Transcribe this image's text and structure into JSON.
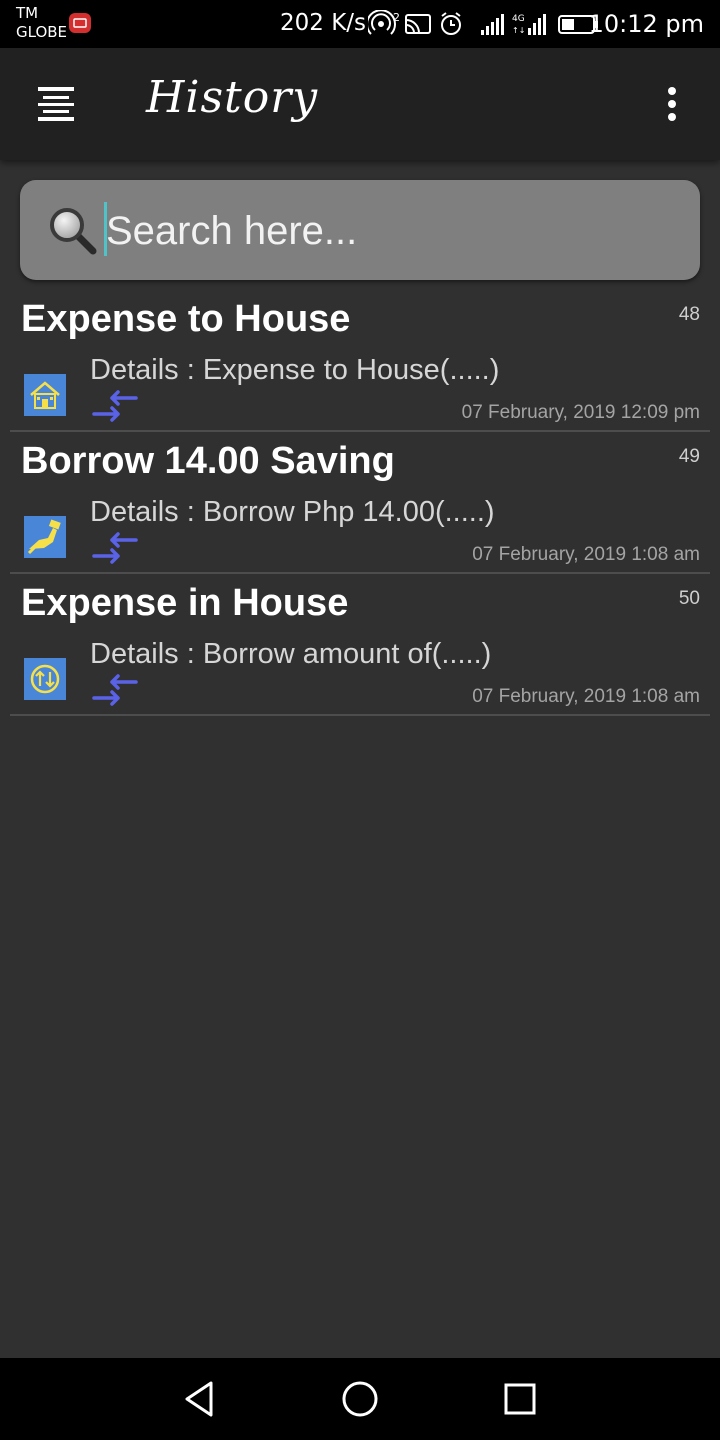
{
  "status_bar": {
    "carrier_line1": "TM",
    "carrier_line2": "GLOBE",
    "net_speed": "202 K/s",
    "time": "10:12 pm",
    "icons": [
      "notification-icon",
      "hotspot-icon",
      "cast-icon",
      "alarm-icon",
      "signal-icon",
      "4g-signal-icon",
      "battery-icon"
    ]
  },
  "app_bar": {
    "title": "History",
    "menu_icon": "hamburger-menu-icon",
    "overflow_icon": "more-vert-icon"
  },
  "search": {
    "placeholder": "Search here...",
    "value": "",
    "icon": "magnifier-icon"
  },
  "history": [
    {
      "title": "Expense to House",
      "number": "48",
      "details": "Details : Expense to House(.....)",
      "date": "07 February, 2019 12:09 pm",
      "icon": "house-icon"
    },
    {
      "title": "Borrow 14.00 Saving",
      "number": "49",
      "details": "Details : Borrow Php 14.00(.....)",
      "date": "07 February, 2019 1:08 am",
      "icon": "hand-money-icon"
    },
    {
      "title": "Expense in House",
      "number": "50",
      "details": "Details : Borrow amount of(.....)",
      "date": "07 February, 2019 1:08 am",
      "icon": "transfer-circle-icon"
    }
  ],
  "nav_bar": {
    "buttons": [
      "back-icon",
      "home-icon",
      "recents-icon"
    ]
  },
  "colors": {
    "background": "#303030",
    "app_bar": "#212121",
    "search_field": "#7f7f7f",
    "icon_blue": "#4a86d8",
    "arrow_blue": "#5a62e8",
    "accent_yellow": "#f5e04a"
  }
}
